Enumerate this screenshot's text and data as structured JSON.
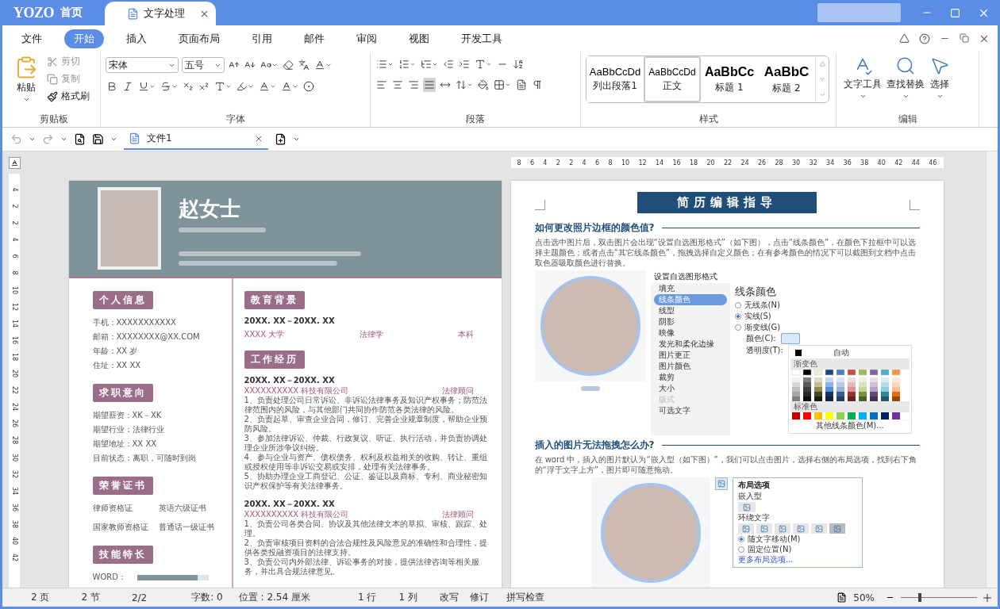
{
  "titlebar": {
    "logo": "YOZO",
    "home": "首页",
    "tabs": [
      {
        "label": "文字处理",
        "selected": true
      }
    ]
  },
  "menu": [
    {
      "label": "文件",
      "selected": false
    },
    {
      "label": "开始",
      "selected": true
    },
    {
      "label": "插入",
      "selected": false
    },
    {
      "label": "页面布局",
      "selected": false
    },
    {
      "label": "引用",
      "selected": false
    },
    {
      "label": "邮件",
      "selected": false
    },
    {
      "label": "审阅",
      "selected": false
    },
    {
      "label": "视图",
      "selected": false
    },
    {
      "label": "开发工具",
      "selected": false
    }
  ],
  "ribbon": {
    "clipboard": {
      "title": "剪贴板",
      "paste": "粘贴",
      "actions": [
        {
          "kind": "cut",
          "label": "剪切",
          "disabled": true
        },
        {
          "kind": "copy",
          "label": "复制",
          "disabled": true
        },
        {
          "kind": "painter",
          "label": "格式刷",
          "disabled": false
        }
      ]
    },
    "font": {
      "title": "字体",
      "font_name": "宋体",
      "font_size": "五号"
    },
    "paragraph": {
      "title": "段落",
      "alignments": [
        {
          "kind": "left",
          "selected": false
        },
        {
          "kind": "center",
          "selected": false
        },
        {
          "kind": "right",
          "selected": false
        },
        {
          "kind": "justify",
          "selected": true
        },
        {
          "kind": "distributed",
          "selected": false
        }
      ]
    },
    "styles": {
      "title": "样式",
      "items": [
        {
          "kind": "list",
          "preview": "AaBbCcDd",
          "label": "列出段落1",
          "selected": false
        },
        {
          "kind": "body",
          "preview": "AaBbCcDd",
          "label": "正文",
          "selected": true
        },
        {
          "kind": "heading1",
          "preview": "AaBbCc",
          "label": "标题 1",
          "selected": false
        },
        {
          "kind": "heading2",
          "preview": "AaBbC",
          "label": "标题 2",
          "selected": false
        }
      ]
    },
    "editing": {
      "title": "编辑",
      "items": [
        {
          "kind": "text_tools",
          "label": "文字工具"
        },
        {
          "kind": "find",
          "label": "查找替换"
        },
        {
          "kind": "select",
          "label": "选择"
        }
      ]
    }
  },
  "quick_bar": {
    "doc_tab": "文件1"
  },
  "ruler": {
    "ticks": [
      "8",
      "6",
      "4",
      "2",
      "2",
      "4",
      "6",
      "8",
      "10",
      "12",
      "14",
      "16",
      "18",
      "20",
      "22",
      "24",
      "26",
      "28",
      "30",
      "32",
      "34",
      "36",
      "38",
      "40",
      "42",
      "44",
      "46"
    ]
  },
  "vruler": {
    "ticks": [
      "4",
      "2",
      "2",
      "4",
      "6",
      "8",
      "10",
      "12",
      "14",
      "16",
      "18",
      "20",
      "22",
      "24",
      "26",
      "28",
      "30",
      "32",
      "34",
      "36",
      "38",
      "40",
      "42"
    ]
  },
  "resume": {
    "name": "赵女士",
    "left": [
      {
        "kind": "lines",
        "title": "个人信息",
        "lines": [
          "手机：XXXXXXXXXXX",
          "邮箱：XXXXXXXX@XX.COM",
          "年龄：XX 岁",
          "住址：XX XX"
        ]
      },
      {
        "kind": "lines",
        "title": "求职意向",
        "lines": [
          "期望薪资：XK－XK",
          "期望行业：法律行业",
          "期望地址：XX XX",
          "目前状态：离职，可随时到岗"
        ]
      },
      {
        "kind": "grid",
        "title": "荣誉证书",
        "lines": [
          "律师资格证",
          "英语六级证书",
          "国家教师资格证",
          "普通话一级证书"
        ]
      },
      {
        "kind": "skills",
        "title": "技能特长",
        "skills": [
          {
            "name": "WORD：",
            "level": 0.85
          }
        ]
      }
    ],
    "right": [
      {
        "kind": "education",
        "title": "教育背景",
        "date": "20XX. XX－20XX. XX",
        "row": [
          "XXXX 大学",
          "法律学",
          "本科"
        ]
      },
      {
        "kind": "jobs",
        "title": "工作经历",
        "jobs": [
          {
            "date": "20XX. XX－20XX. XX",
            "company": "XXXXXXXXXX 科技有限公司",
            "role": "法律顾问",
            "items": [
              "1、负责处理公司日常诉讼、非诉讼法律事务及知识产权事务；防范法律范围内的风险，与其他部门共同协作防范各类法律的风险。",
              "2、负责起草、审查企业合同，修订、完善企业规章制度，帮助企业预防风险。",
              "3、参加法律诉讼、仲裁、行政复议、听证、执行活动，并负责协调处理企业所涉争议纠纷。",
              "4、参与企业与资产、债权债务、权利及权益相关的收购、转让、重组或授权使用等非诉讼交易或安排，处理有关法律事务。",
              "5、协助办理企业工商登记、公证、鉴证以及商标、专利、商业秘密知识产权保护等有关法律事务。"
            ]
          },
          {
            "date": "20XX. XX－20XX. XX",
            "company": "XXXXXXXXXX 科技有限公司",
            "role": "法律顾问",
            "items": [
              "1、负责公司各类合同、协议及其他法律文本的草拟、审核、跟踪、处理。",
              "2、负责审核项目资料的合法合规性及风险意见的准确性和合理性，提供各类投融资项目的法律支持。",
              "3、负责公司内外部法律、诉讼事务的对接，提供法律咨询等相关服务，并出具合规法律意见。"
            ]
          }
        ]
      }
    ]
  },
  "guide": {
    "title": "简历编辑指导",
    "sections": [
      {
        "heading": "如何更改照片边框的颜色值?",
        "text": "点击选中图片后，双击图片会出现“设置自选图形格式”（如下图），点击“线条颜色”，在颜色下拉框中可以选择主题颜色；或者点击“其它线条颜色”，拖拽选择自定义颜色；在有参考颜色的情况下可以截图到文档中点击取色器吸取颜色进行替换。",
        "figure": {
          "kind": "format_dialog",
          "title": "设置自选图形格式",
          "nav": [
            {
              "label": "填充",
              "selected": false,
              "disabled": false
            },
            {
              "label": "线条颜色",
              "selected": true,
              "disabled": false
            },
            {
              "label": "线型",
              "selected": false,
              "disabled": false
            },
            {
              "label": "阴影",
              "selected": false,
              "disabled": false
            },
            {
              "label": "映像",
              "selected": false,
              "disabled": false
            },
            {
              "label": "发光和柔化边缘",
              "selected": false,
              "disabled": false
            },
            {
              "label": "图片更正",
              "selected": false,
              "disabled": false
            },
            {
              "label": "图片颜色",
              "selected": false,
              "disabled": false
            },
            {
              "label": "裁剪",
              "selected": false,
              "disabled": false
            },
            {
              "label": "大小",
              "selected": false,
              "disabled": false
            },
            {
              "label": "版式",
              "selected": false,
              "disabled": true
            },
            {
              "label": "可选文字",
              "selected": false,
              "disabled": false
            }
          ],
          "heading": "线条颜色",
          "options": [
            {
              "label": "无线条(N)",
              "selected": false
            },
            {
              "label": "实线(S)",
              "selected": true
            },
            {
              "label": "渐变线(G)",
              "selected": false
            }
          ],
          "color_label": "颜色(C):",
          "transparency_label": "透明度(T):",
          "auto": "自动",
          "gradient_title": "渐变色",
          "standard_title": "标准色",
          "more": "其他线条颜色(M)..."
        }
      },
      {
        "heading": "插入的图片无法拖拽怎么办?",
        "text": "在 word 中，插入的图片默认为“嵌入型（如下图）”，我们可以点击图片，选择右侧的布局选项，找到右下角的“浮于文字上方”，图片即可随意拖动。",
        "figure": {
          "kind": "layout_panel",
          "title": "布局选项",
          "inline_label": "嵌入型",
          "wrap_label": "环绕文字",
          "options": [
            {
              "label": "随文字移动(M)",
              "selected": true
            },
            {
              "label": "固定位置(N)",
              "selected": false
            }
          ],
          "more": "更多布局选项..."
        }
      }
    ]
  },
  "status_bar": [
    "2 页",
    "2 节",
    "2/2",
    "字数: 0",
    "位置 : 2.54 厘米",
    "1 行",
    "1 列",
    "改写",
    "修订",
    "拼写检查"
  ],
  "zoom": {
    "reading": "50%",
    "level": 0.25
  }
}
